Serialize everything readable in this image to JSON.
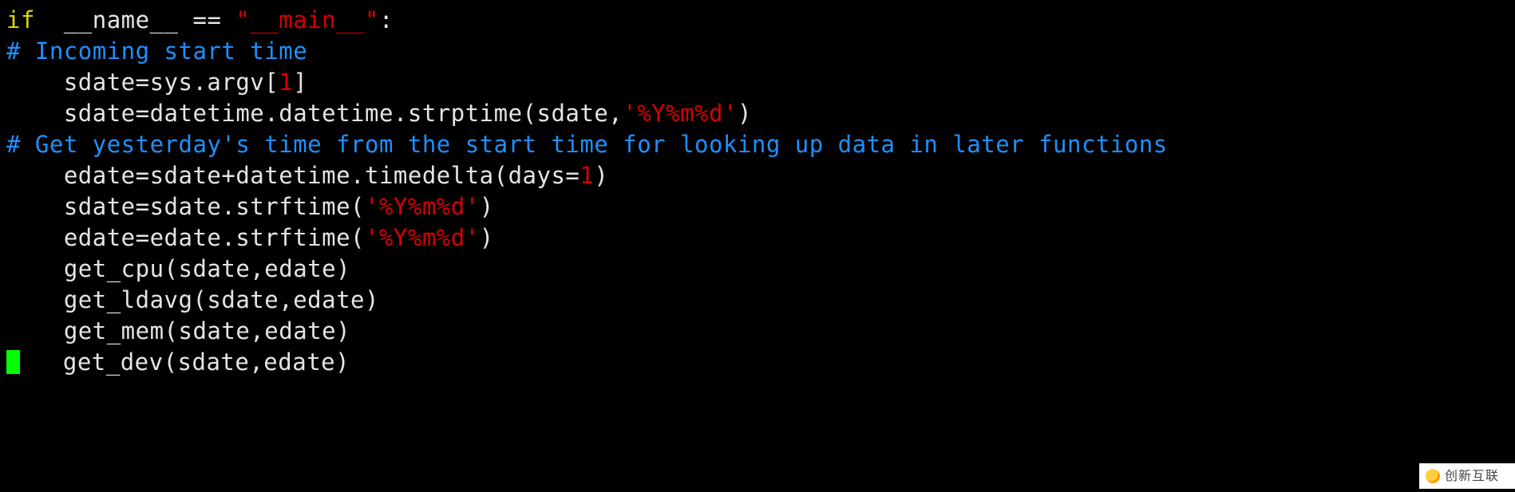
{
  "code": {
    "line1": {
      "kw": "if",
      "ident": "  __name__ ",
      "op": "== ",
      "str": "\"__main__\"",
      "end": ":"
    },
    "line2": {
      "comment": "# Incoming start time"
    },
    "line3": {
      "pre": "    sdate=sys.argv[",
      "num": "1",
      "post": "]"
    },
    "line4": {
      "pre": "    sdate=datetime.datetime.strptime(sdate,",
      "str": "'%Y%m%d'",
      "post": ")"
    },
    "line5": {
      "comment": "# Get yesterday's time from the start time for looking up data in later functions"
    },
    "line6": {
      "pre": "    edate=sdate+datetime.timedelta(days=",
      "num": "1",
      "post": ")"
    },
    "line7": {
      "pre": "    sdate=sdate.strftime(",
      "str": "'%Y%m%d'",
      "post": ")"
    },
    "line8": {
      "pre": "    edate=edate.strftime(",
      "str": "'%Y%m%d'",
      "post": ")"
    },
    "line9": {
      "text": "    get_cpu(sdate,edate)"
    },
    "line10": {
      "text": "    get_ldavg(sdate,edate)"
    },
    "line11": {
      "text": "    get_mem(sdate,edate)"
    },
    "line12": {
      "text": "   get_dev(sdate,edate)"
    }
  },
  "watermark": {
    "text": "创新互联"
  }
}
